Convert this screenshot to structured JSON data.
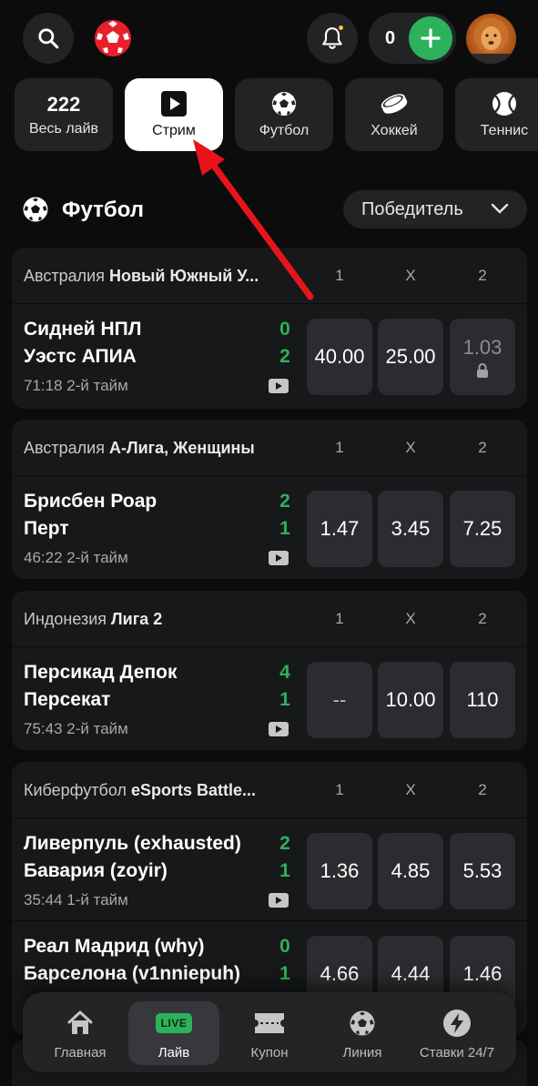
{
  "header": {
    "balance": "0"
  },
  "chips": [
    {
      "count": "222",
      "label": "Весь лайв",
      "icon": "none"
    },
    {
      "label": "Стрим",
      "icon": "play-icon",
      "active": true
    },
    {
      "label": "Футбол",
      "icon": "soccer-ball-icon"
    },
    {
      "label": "Хоккей",
      "icon": "hockey-puck-icon"
    },
    {
      "label": "Теннис",
      "icon": "tennis-ball-icon"
    }
  ],
  "section": {
    "title": "Футбол",
    "market": "Победитель"
  },
  "odds_headers": [
    "1",
    "X",
    "2"
  ],
  "leagues": [
    {
      "country": "Австралия",
      "name": "Новый Южный У...",
      "matches": [
        {
          "team1": "Сидней НПЛ",
          "team2": "Уэстс АПИА",
          "score1": "0",
          "score2": "2",
          "time": "71:18 2-й тайм",
          "odds": [
            "40.00",
            "25.00",
            "1.03"
          ],
          "locked": [
            false,
            false,
            true
          ]
        }
      ]
    },
    {
      "country": "Австралия",
      "name": "А-Лига, Женщины",
      "matches": [
        {
          "team1": "Брисбен Роар",
          "team2": "Перт",
          "score1": "2",
          "score2": "1",
          "time": "46:22 2-й тайм",
          "odds": [
            "1.47",
            "3.45",
            "7.25"
          ],
          "locked": [
            false,
            false,
            false
          ]
        }
      ]
    },
    {
      "country": "Индонезия",
      "name": "Лига 2",
      "matches": [
        {
          "team1": "Персикад Депок",
          "team2": "Персекат",
          "score1": "4",
          "score2": "1",
          "time": "75:43 2-й тайм",
          "odds": [
            "--",
            "10.00",
            "110"
          ],
          "locked": [
            false,
            false,
            false
          ]
        }
      ]
    },
    {
      "country": "Киберфутбол",
      "name": "eSports Battle...",
      "matches": [
        {
          "team1": "Ливерпуль (exhausted)",
          "team2": "Бавария (zoyir)",
          "score1": "2",
          "score2": "1",
          "time": "35:44 1-й тайм",
          "odds": [
            "1.36",
            "4.85",
            "5.53"
          ],
          "locked": [
            false,
            false,
            false
          ]
        },
        {
          "team1": "Реал Мадрид (why)",
          "team2": "Барселона (v1nniepuh)",
          "score1": "0",
          "score2": "1",
          "time": "",
          "odds": [
            "4.66",
            "4.44",
            "1.46"
          ],
          "locked": [
            false,
            false,
            false
          ]
        }
      ]
    }
  ],
  "bottom_nav": [
    {
      "label": "Главная",
      "icon": "home-icon"
    },
    {
      "label": "Лайв",
      "icon": "live-badge",
      "badge": "LIVE",
      "active": true
    },
    {
      "label": "Купон",
      "icon": "coupon-icon"
    },
    {
      "label": "Линия",
      "icon": "soccer-ball-icon"
    },
    {
      "label": "Ставки 24/7",
      "icon": "lightning-icon"
    }
  ],
  "colors": {
    "accent_green": "#2cb25b",
    "brand_red": "#e7202b",
    "annotation_arrow": "#e8141b"
  }
}
